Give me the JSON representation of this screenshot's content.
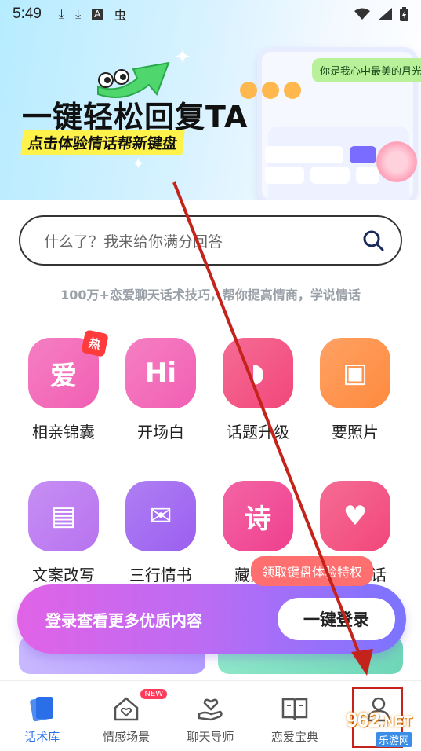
{
  "status_bar": {
    "time": "5:49",
    "icons": [
      "download-icon",
      "download-icon",
      "a-keyboard-icon",
      "bug-icon"
    ],
    "right_icons": [
      "wifi-icon",
      "signal-icon",
      "battery-icon"
    ]
  },
  "banner": {
    "title": "一键轻松回复TA",
    "subtitle": "点击体验情话帮新键盘",
    "bubble": "你是我心中最美的月光"
  },
  "search": {
    "placeholder": "什么了？我来给你满分回答"
  },
  "tagline": "100万+恋爱聊天话术技巧，帮你提高情商，学说情话",
  "grid": [
    {
      "label": "相亲锦囊",
      "icon": "money-bag-icon",
      "color": "#f25fb3",
      "glyph": "爱",
      "badge": "热"
    },
    {
      "label": "开场白",
      "icon": "hi-chat-icon",
      "color": "#f25fb3",
      "glyph": "Hi"
    },
    {
      "label": "话题升级",
      "icon": "lips-icon",
      "color": "#f2477a",
      "glyph": "◗"
    },
    {
      "label": "要照片",
      "icon": "photo-icon",
      "color": "#ff8a3d",
      "glyph": "▣"
    },
    {
      "label": "文案改写",
      "icon": "document-icon",
      "color": "#b873f0",
      "glyph": "▤"
    },
    {
      "label": "三行情书",
      "icon": "love-letter-icon",
      "color": "#9b5ff0",
      "glyph": "✉"
    },
    {
      "label": "藏头诗",
      "icon": "poem-icon",
      "color": "#f03f8e",
      "glyph": "诗"
    },
    {
      "label": "土味情话",
      "icon": "heart-chat-icon",
      "color": "#f2477a",
      "glyph": "♥"
    }
  ],
  "tooltip": "领取键盘体验特权",
  "login": {
    "text": "登录查看更多优质内容",
    "button": "一键登录"
  },
  "tabs": [
    {
      "label": "话术库",
      "icon": "cards-icon",
      "active": true
    },
    {
      "label": "情感场景",
      "icon": "house-heart-icon",
      "badge": "NEW"
    },
    {
      "label": "聊天导师",
      "icon": "hand-heart-icon"
    },
    {
      "label": "恋爱宝典",
      "icon": "book-icon"
    },
    {
      "label": "我的",
      "icon": "person-icon"
    }
  ],
  "watermark": {
    "number": "962",
    "net": ".NET",
    "sub": "乐游网"
  }
}
